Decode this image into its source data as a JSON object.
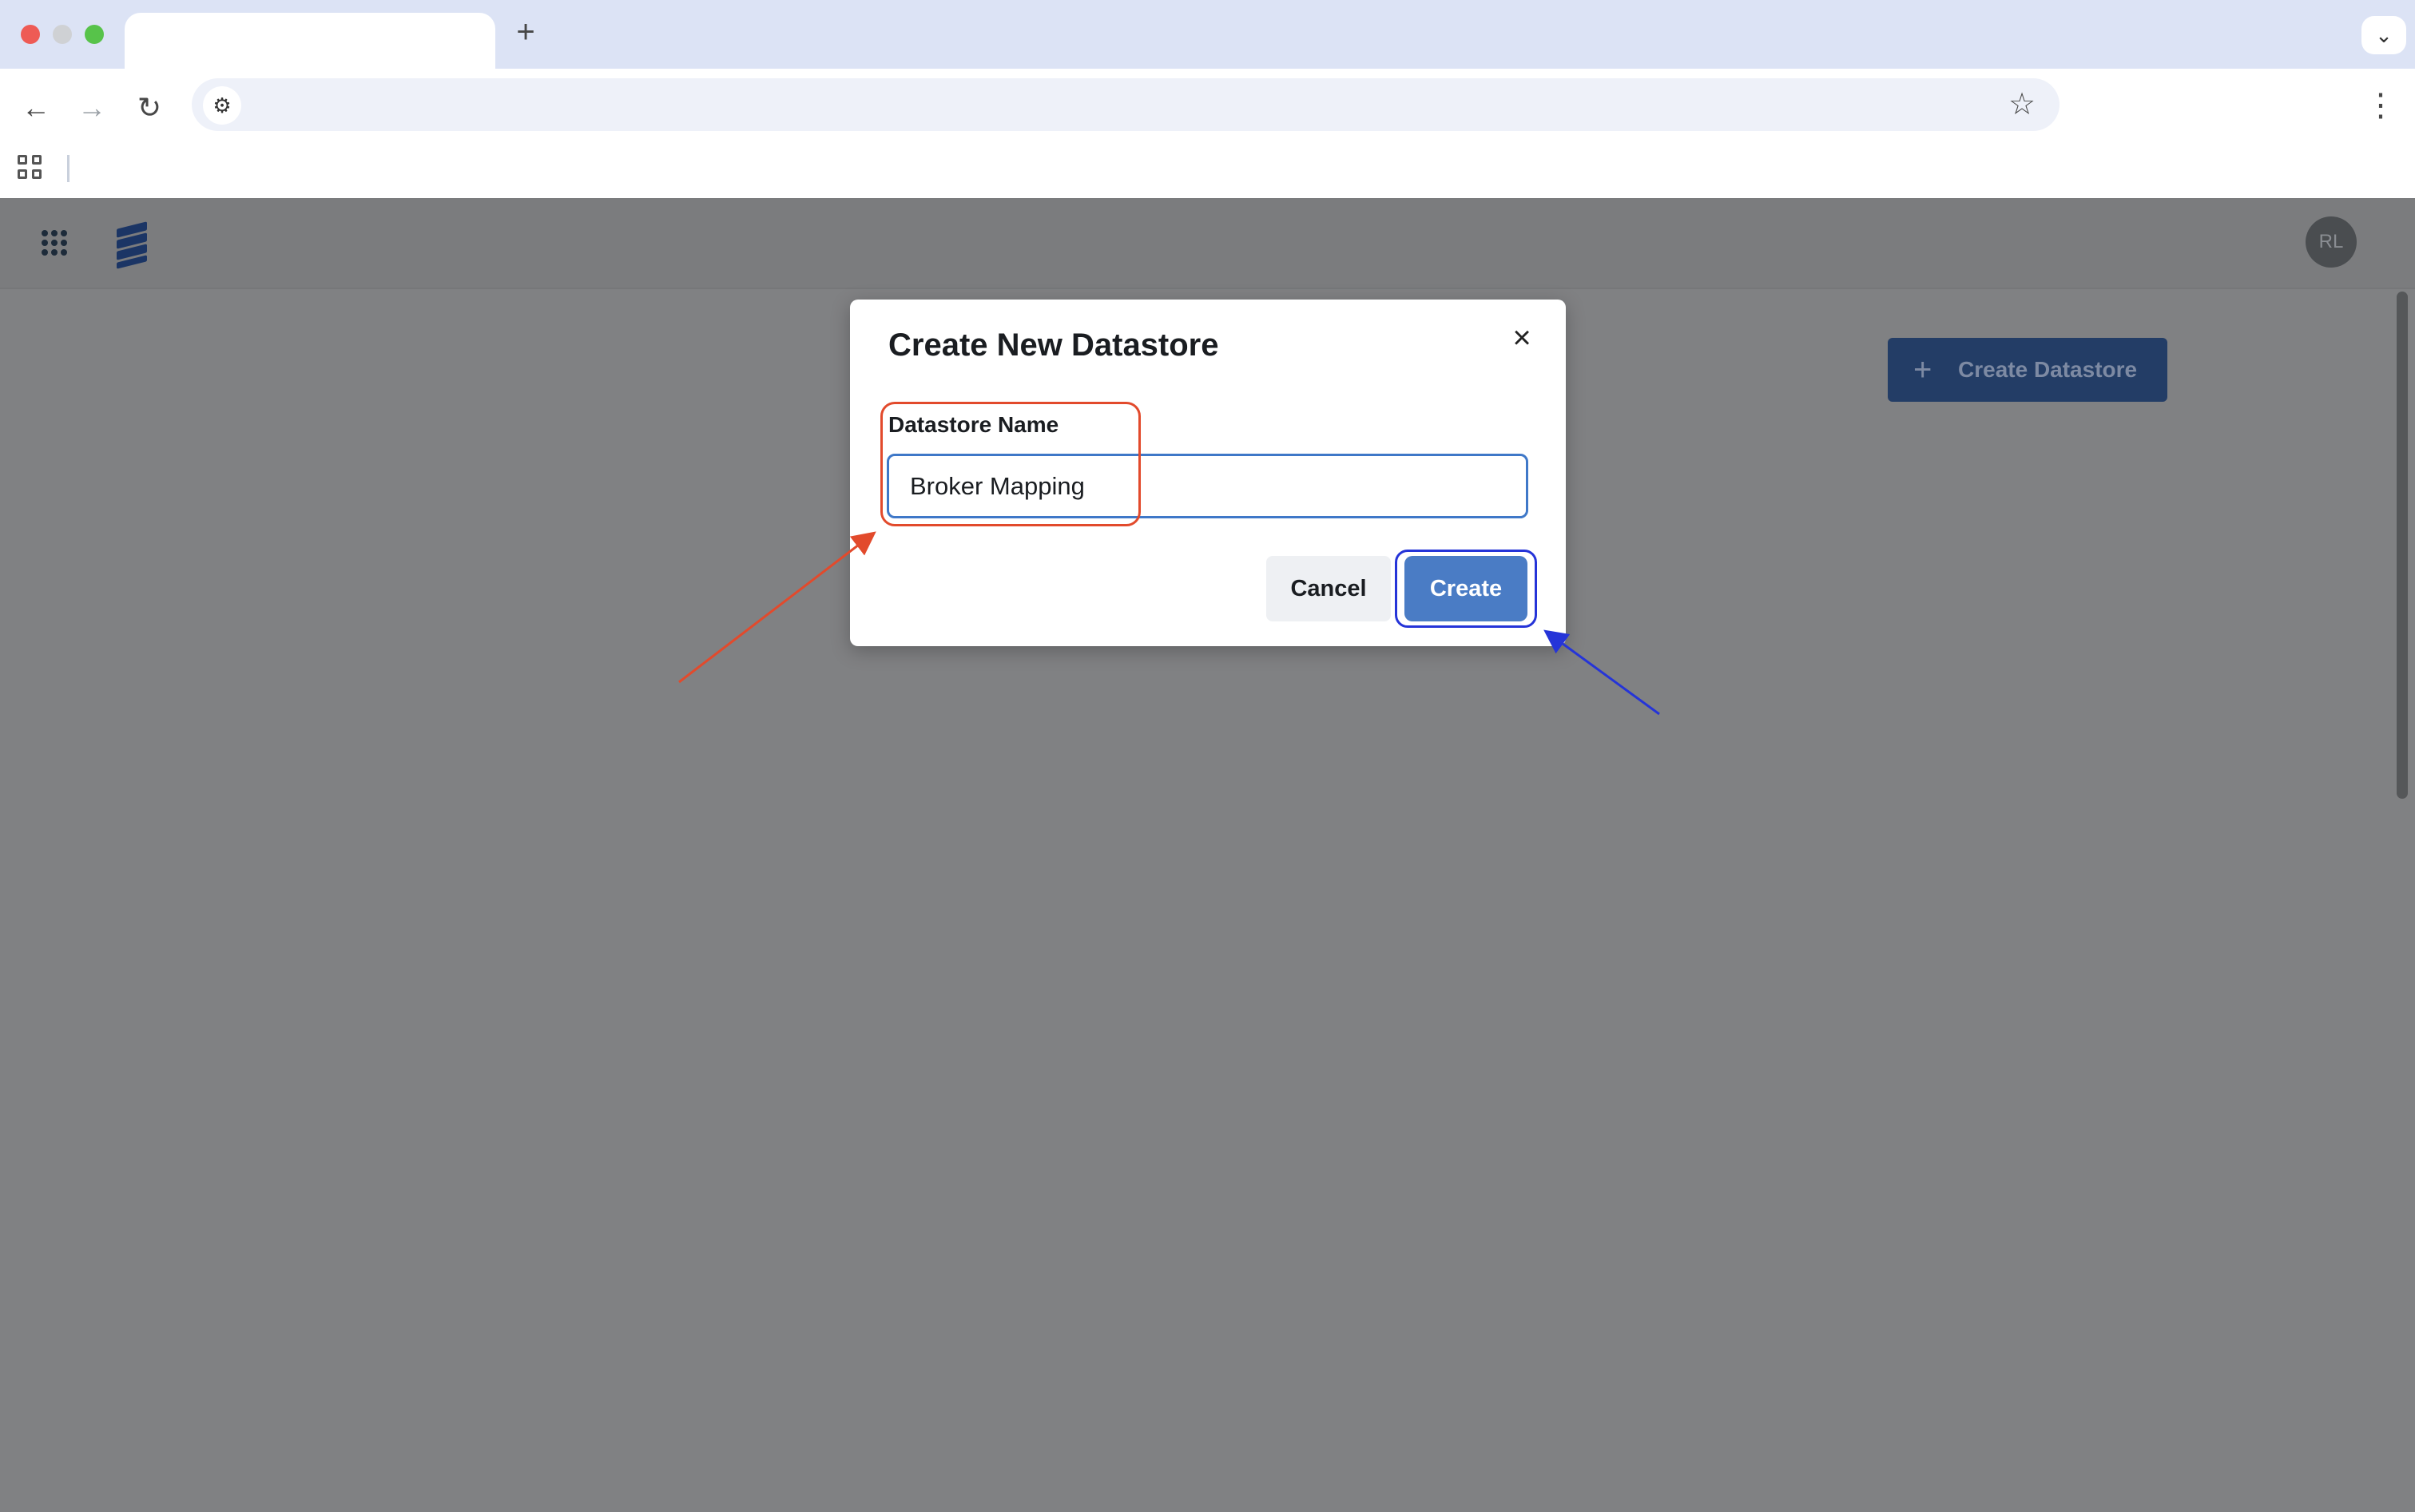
{
  "browser": {
    "new_tab": "+",
    "tab_dropdown": "⌄",
    "back": "←",
    "forward": "→",
    "reload": "↻",
    "site_info": "⚙",
    "bookmark": "☆",
    "menu": "⋮"
  },
  "app": {
    "avatar_initials": "RL",
    "create_datastore_label": "Create Datastore",
    "create_datastore_icon": "plus-icon"
  },
  "modal": {
    "title": "Create New Datastore",
    "close": "×",
    "field_label": "Datastore Name",
    "field_value": "Broker Mapping",
    "cancel_label": "Cancel",
    "create_label": "Create"
  },
  "annotations": {
    "red_color": "#e24a2c",
    "blue_color": "#2534d8"
  }
}
